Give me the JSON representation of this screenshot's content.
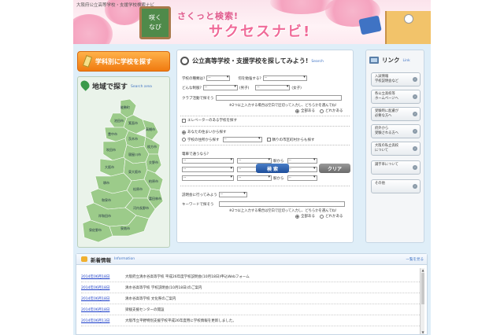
{
  "header": {
    "site_title": "大阪府公立高等学校・支援学校検索ナビ",
    "logo_line1": "咲く",
    "logo_line2": "なび",
    "tagline": "さくっと検索!",
    "brand": "サクセスナビ!"
  },
  "left": {
    "subject_button": "学科別に学校を探す",
    "area_title": "地域で探す",
    "area_sub": "Search area",
    "map_labels": [
      "能勢町",
      "豊能町",
      "池田市",
      "箕面市",
      "茨木市",
      "高槻市",
      "島本町",
      "豊中市",
      "吹田市",
      "摂津市",
      "枚方市",
      "交野市",
      "寝屋川市",
      "大阪市",
      "守口市",
      "門真市",
      "四條畷市",
      "大東市",
      "東大阪市",
      "八尾市",
      "柏原市",
      "堺市",
      "松原市",
      "藤井寺市",
      "羽曳野市",
      "富田林市",
      "河内長野市",
      "和泉市",
      "岸和田市",
      "貝塚市",
      "泉佐野市",
      "熊取町",
      "田尻町",
      "泉南市",
      "阪南市",
      "岬町",
      "高石市",
      "泉大津市",
      "忠岡町",
      "太子町",
      "河南町",
      "千早赤阪村",
      "大阪狭山市"
    ]
  },
  "form": {
    "title": "公立高等学校・支援学校を探してみよう!",
    "sub": "Search",
    "school_type_label": "学校の種類は?",
    "school_type_value": "--",
    "study_label": "何を勉強する?",
    "study_value": "--",
    "uniform_label": "どんな制服?",
    "uniform_value": "--",
    "male_label": "(男子)",
    "female_value": "--",
    "female_label": "(女子)",
    "club_label": "クラブ活動で探そう",
    "note1": "※2つ以上入力する場合は空白で区切って入力し、どちらかを選んでね!",
    "opt_all": "全部ある",
    "opt_any": "どれかある",
    "elevator_label": "エレベーターのある学校を探す",
    "from_home_label": "あなたの住まいから探す",
    "from_school_label": "学校の住所から探す",
    "location_value": "--",
    "neighbor_label": "隣りの市区町村からも探す",
    "train_label": "電車で通うなら?",
    "train_rows": [
      {
        "line": "--",
        "station": "--",
        "from": "駅から",
        "time": "--"
      },
      {
        "line": "--",
        "station": "--",
        "from": "駅から",
        "time": "--"
      },
      {
        "line": "--",
        "station": "--",
        "from": "駅から",
        "time": "--"
      }
    ],
    "briefing_label": "説明会に行ってみよう",
    "briefing_value": "--",
    "keyword_label": "キーワードで探そう",
    "note2": "※2つ以上入力する場合は空白で区切って入力し、どちらかを選んでね!",
    "search_button": "検 索",
    "clear_button": "クリア"
  },
  "links": {
    "title": "リンク",
    "sub": "Link",
    "items": [
      "入試情報\n学校説明会など",
      "各公立高校等\nホームページへ",
      "受験時に配慮が\n必要な方へ",
      "府外から\n受験される方へ",
      "大阪の私立高校\nについて",
      "識字率について",
      "その他"
    ]
  },
  "news": {
    "title": "新着情報",
    "sub": "Information",
    "more": "一覧を見る",
    "items": [
      {
        "date": "2014年06月18日",
        "text": "大阪府立清水谷高等学校 平成26年度学校説明会(10月18日)申込Webフォーム"
      },
      {
        "date": "2014年06月18日",
        "text": "清水谷高等学校 学校説明会(10月18日)のご案内"
      },
      {
        "date": "2014年06月18日",
        "text": "清水谷高等学校 文化祭のご案内"
      },
      {
        "date": "2014年06月18日",
        "text": "梁稜支援センターの開設"
      },
      {
        "date": "2014年06月13日",
        "text": "大阪市立平野特別支援学校平成26年度用に学校情報を更新しました。"
      }
    ]
  },
  "colors": {
    "page_bg": "#dfeef8",
    "accent_orange": "#f07a10",
    "brand_pink": "#f06a98",
    "map_green": "#9ccb8a",
    "search_blue": "#1d4d9a"
  }
}
